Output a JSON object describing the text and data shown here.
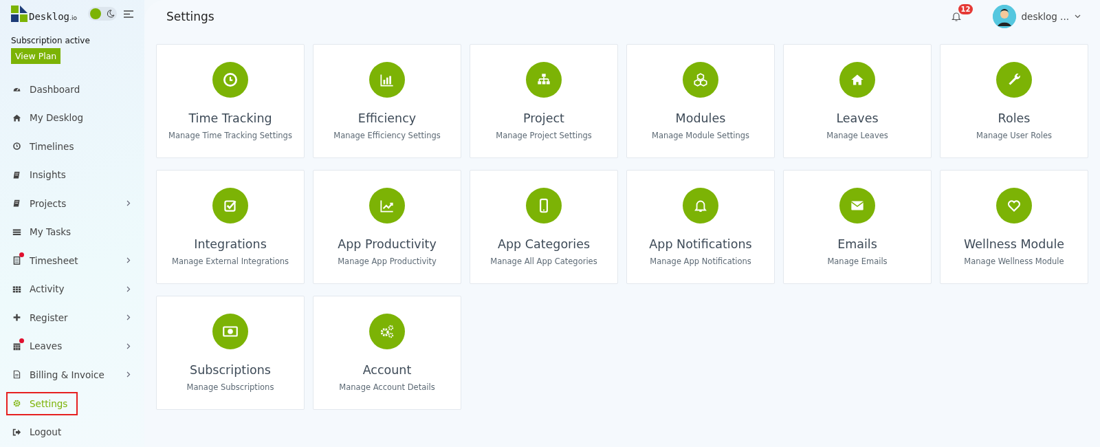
{
  "brand": {
    "name": "Desklog",
    "suffix": ".io"
  },
  "theme_toggle": {
    "dark_mode": false
  },
  "subscription": {
    "status": "Subscription active",
    "button": "View Plan"
  },
  "sidebar": {
    "items": [
      {
        "label": "Dashboard",
        "kind": "dashboard",
        "submenu": false,
        "dot": false,
        "selected": false
      },
      {
        "label": "My Desklog",
        "kind": "home",
        "submenu": false,
        "dot": false,
        "selected": false
      },
      {
        "label": "Timelines",
        "kind": "clock",
        "submenu": false,
        "dot": false,
        "selected": false
      },
      {
        "label": "Insights",
        "kind": "book",
        "submenu": false,
        "dot": false,
        "selected": false
      },
      {
        "label": "Projects",
        "kind": "book",
        "submenu": true,
        "dot": false,
        "selected": false
      },
      {
        "label": "My Tasks",
        "kind": "tasks",
        "submenu": false,
        "dot": false,
        "selected": false
      },
      {
        "label": "Timesheet",
        "kind": "sheet",
        "submenu": true,
        "dot": true,
        "selected": false
      },
      {
        "label": "Activity",
        "kind": "grid",
        "submenu": true,
        "dot": false,
        "selected": false
      },
      {
        "label": "Register",
        "kind": "plus",
        "submenu": true,
        "dot": false,
        "selected": false
      },
      {
        "label": "Leaves",
        "kind": "calendar",
        "submenu": true,
        "dot": true,
        "selected": false
      },
      {
        "label": "Billing & Invoice",
        "kind": "file",
        "submenu": true,
        "dot": false,
        "selected": false
      },
      {
        "label": "Settings",
        "kind": "gear",
        "submenu": false,
        "dot": false,
        "selected": true
      },
      {
        "label": "Logout",
        "kind": "logout",
        "submenu": false,
        "dot": false,
        "selected": false
      }
    ]
  },
  "header": {
    "title": "Settings",
    "notifications": "12",
    "user": "desklog ..."
  },
  "cards": [
    {
      "kind": "clock",
      "title": "Time Tracking",
      "subtitle": "Manage Time Tracking Settings"
    },
    {
      "kind": "bars",
      "title": "Efficiency",
      "subtitle": "Manage Efficiency Settings"
    },
    {
      "kind": "sitemap",
      "title": "Project",
      "subtitle": "Manage Project Settings"
    },
    {
      "kind": "cubes",
      "title": "Modules",
      "subtitle": "Manage Module Settings"
    },
    {
      "kind": "home",
      "title": "Leaves",
      "subtitle": "Manage Leaves"
    },
    {
      "kind": "wrench",
      "title": "Roles",
      "subtitle": "Manage User Roles"
    },
    {
      "kind": "check",
      "title": "Integrations",
      "subtitle": "Manage External Integrations"
    },
    {
      "kind": "trend",
      "title": "App Productivity",
      "subtitle": "Manage App Productivity"
    },
    {
      "kind": "phone",
      "title": "App Categories",
      "subtitle": "Manage All App Categories"
    },
    {
      "kind": "bell",
      "title": "App Notifications",
      "subtitle": "Manage App Notifications"
    },
    {
      "kind": "mail",
      "title": "Emails",
      "subtitle": "Manage Emails"
    },
    {
      "kind": "heart",
      "title": "Wellness Module",
      "subtitle": "Manage Wellness Module"
    },
    {
      "kind": "money",
      "title": "Subscriptions",
      "subtitle": "Manage Subscriptions"
    },
    {
      "kind": "gears",
      "title": "Account",
      "subtitle": "Manage Account Details"
    }
  ]
}
